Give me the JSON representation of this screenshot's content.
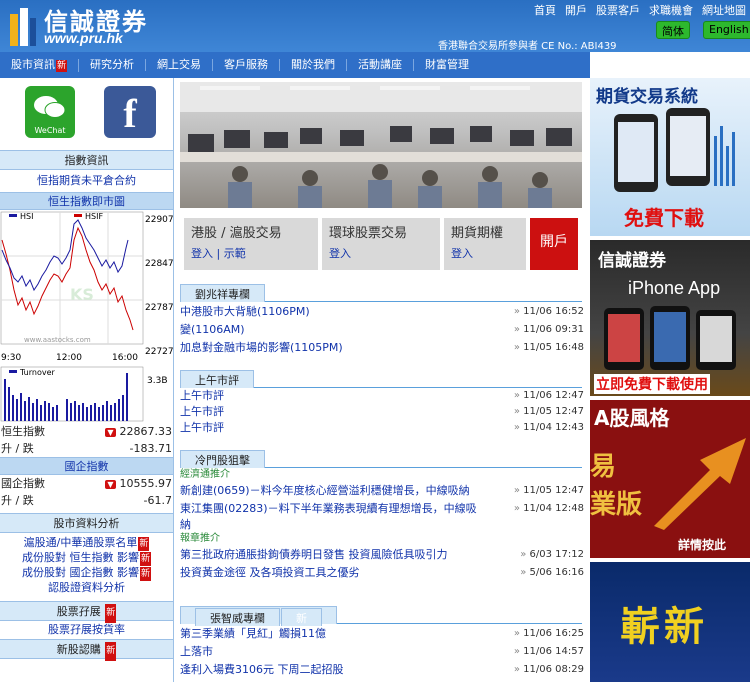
{
  "header": {
    "logo_text": "信誠證券",
    "logo_url": "www.pru.hk",
    "top_links": [
      "首頁",
      "開戶",
      "股票客戶",
      "求職機會",
      "網址地圖"
    ],
    "exchange_text": "香港聯合交易所參與者 CE No.: ABI439",
    "lang_sc": "简体",
    "lang_en": "English"
  },
  "nav": [
    {
      "label": "股市資訊",
      "new": "新"
    },
    {
      "label": "研究分析"
    },
    {
      "label": "網上交易"
    },
    {
      "label": "客戶服務"
    },
    {
      "label": "關於我們"
    },
    {
      "label": "活動講座"
    },
    {
      "label": "財富管理"
    }
  ],
  "left": {
    "wechat_label": "WeChat",
    "fb_label": "f",
    "index_info_head": "指數資訊",
    "index_info_link": "恒指期貨未平倉合約",
    "hsi_chart_head": "恒生指數即市圖",
    "legend_hsi": "HSI",
    "legend_hsif": "HSIF",
    "yticks": [
      "22907",
      "22847",
      "22787",
      "22727"
    ],
    "xticks": [
      "9:30",
      "12:00",
      "16:00"
    ],
    "watermark": "www.aastocks.com",
    "turnover_label": "Turnover",
    "turnover_tick": "3.3B",
    "hsi_label": "恒生指數",
    "hsi_value": "22867.33",
    "hsi_change_label": "升 / 跌",
    "hsi_change": "-183.71",
    "china_head": "國企指數",
    "china_label": "國企指數",
    "china_value": "10555.97",
    "china_change_label": "升 / 跌",
    "china_change": "-61.7",
    "analysis_head": "股市資料分析",
    "analysis_links": [
      {
        "label": "滬股通/中華通股票名單",
        "new": "新"
      },
      {
        "label": "成份股對 恒生指數 影響",
        "new": "新"
      },
      {
        "label": "成份股對 國企指數 影響",
        "new": "新"
      },
      {
        "label": "認股證資料分析"
      }
    ],
    "margin_head": "股票孖展",
    "margin_new": "新",
    "margin_link": "股票孖展按貨率",
    "ipo_head": "新股認購",
    "ipo_new": "新"
  },
  "center": {
    "tabs": [
      {
        "title": "港股 / 滬股交易",
        "links": [
          "登入",
          "示範"
        ]
      },
      {
        "title": "環球股票交易",
        "links": [
          "登入"
        ]
      },
      {
        "title": "期貨期權",
        "links": [
          "登入"
        ]
      }
    ],
    "open_account": "開戶",
    "columns": [
      {
        "head": "劉兆祥專欄",
        "items": [
          {
            "title": "中港股市大背馳(1106PM)",
            "date": "11/06 16:52"
          },
          {
            "title": "變(1106AM)",
            "date": "11/06 09:31"
          },
          {
            "title": "加息對金融市場的影響(1105PM)",
            "date": "11/05 16:48"
          }
        ]
      },
      {
        "head": "上午市評",
        "items": [
          {
            "title": "上午市評",
            "date": "11/06 12:47"
          },
          {
            "title": "上午市評",
            "date": "11/05 12:47"
          },
          {
            "title": "上午市評",
            "date": "11/04 12:43"
          }
        ]
      },
      {
        "head": "冷門股狙擊",
        "cat1": "經濟通推介",
        "items1": [
          {
            "title": "新創建(0659)－料今年度核心經營溢利穩健增長，中線吸納",
            "date": "11/05 12:47"
          },
          {
            "title": "東江集團(02283)－料下半年業務表現續有理想增長，中線吸",
            "title2": "納",
            "date": "11/04 12:48"
          }
        ],
        "cat2": "報章推介",
        "items2": [
          {
            "title": "第三批政府通脹掛鉤債券明日發售 投資風險低具吸引力",
            "date": "6/03 17:12"
          },
          {
            "title": "投資黃金途徑 及各項投資工具之優劣",
            "date": "5/06 16:16"
          }
        ]
      },
      {
        "head": "張智威專欄",
        "new": "新",
        "items": [
          {
            "title": "第三季業績「見紅」觸損11億",
            "date": "11/06 16:25"
          },
          {
            "title": "上落市",
            "date": "11/06 14:57"
          },
          {
            "title": "逢利入場費3106元 下周二起招股",
            "date": "11/06 08:29"
          }
        ]
      }
    ]
  },
  "right": {
    "ad1_title": "期貨交易系統",
    "ad1_cta": "免費下載",
    "ad2_title": "信誠證券",
    "ad2_sub": "iPhone App",
    "ad2_cta": "立即免費下載使用",
    "ad3_title": "A股風格",
    "ad3_side": "易",
    "ad3_side2": "業版",
    "ad3_cta": "詳情按此",
    "ad4_title": "嶄新"
  }
}
